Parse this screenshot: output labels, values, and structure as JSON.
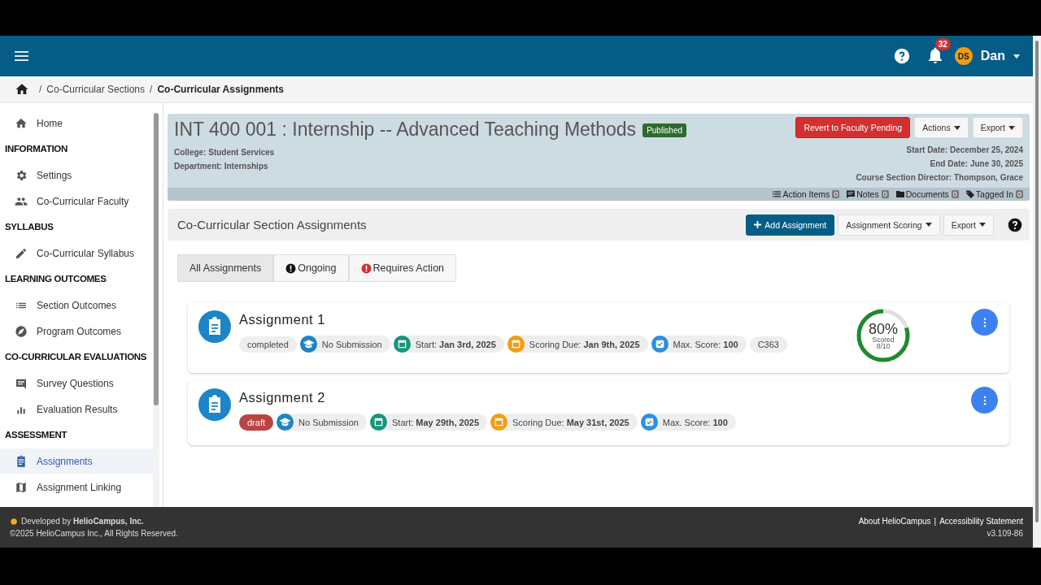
{
  "header": {
    "notification_count": "32",
    "avatar_initials": "DS",
    "user": "Dan"
  },
  "breadcrumb": [
    {
      "separator": "/",
      "label": "Co-Curricular Sections",
      "current": false
    },
    {
      "separator": "/",
      "label": "Co-Curricular Assignments",
      "current": true
    }
  ],
  "sidebar": {
    "items": [
      {
        "kind": "link",
        "label": "Home",
        "selected": false
      },
      {
        "kind": "heading",
        "label": "INFORMATION"
      },
      {
        "kind": "link",
        "label": "Settings",
        "selected": false
      },
      {
        "kind": "link",
        "label": "Co-Curricular Faculty",
        "selected": false
      },
      {
        "kind": "heading",
        "label": "SYLLABUS"
      },
      {
        "kind": "link",
        "label": "Co-Curricular Syllabus",
        "selected": false
      },
      {
        "kind": "heading",
        "label": "LEARNING OUTCOMES"
      },
      {
        "kind": "link",
        "label": "Section Outcomes",
        "selected": false
      },
      {
        "kind": "link",
        "label": "Program Outcomes",
        "selected": false
      },
      {
        "kind": "heading",
        "label": "CO-CURRICULAR EVALUATIONS"
      },
      {
        "kind": "link",
        "label": "Survey Questions",
        "selected": false
      },
      {
        "kind": "link",
        "label": "Evaluation Results",
        "selected": false
      },
      {
        "kind": "heading",
        "label": "ASSESSMENT"
      },
      {
        "kind": "link",
        "label": "Assignments",
        "selected": true
      },
      {
        "kind": "link",
        "label": "Assignment Linking",
        "selected": false
      }
    ]
  },
  "course": {
    "title": "INT 400 001 : Internship -- Advanced Teaching Methods",
    "status": "Published",
    "college": "College: Student Services",
    "department": "Department: Internships",
    "buttons": [
      {
        "label": "Revert to Faculty Pending",
        "kind": "danger"
      },
      {
        "label": "Actions",
        "kind": "dropdown"
      },
      {
        "label": "Export",
        "kind": "dropdown"
      }
    ],
    "details": [
      "Start Date: December 25, 2024",
      "End Date: June 30, 2025",
      "Course Section Director: Thompson, Grace"
    ],
    "counters": [
      {
        "label": "Action Items",
        "count": "0"
      },
      {
        "label": "Notes",
        "count": "0"
      },
      {
        "label": "Documents",
        "count": "0"
      },
      {
        "label": "Tagged In",
        "count": "0"
      }
    ]
  },
  "section": {
    "title": "Co-Curricular Section Assignments",
    "buttons": [
      {
        "label": "Add Assignment",
        "kind": "primary"
      },
      {
        "label": "Assignment Scoring",
        "kind": "dropdown"
      },
      {
        "label": "Export",
        "kind": "dropdown"
      }
    ]
  },
  "filters": [
    {
      "label": "All Assignments",
      "selected": true
    },
    {
      "label": "Ongoing",
      "selected": false
    },
    {
      "label": "Requires Action",
      "selected": false
    }
  ],
  "assignments": [
    {
      "title": "Assignment 1",
      "status": {
        "label": "completed",
        "kind": "completed"
      },
      "submission": "No Submission",
      "start": "Start: **Jan 3rd, 2025**",
      "due": "Scoring Due: **Jan 9th, 2025**",
      "max_score": "Max. Score: **100**",
      "code": "C363",
      "score": {
        "percent": "80%",
        "label": "Scored",
        "fraction": "8/10",
        "level": 0.8
      }
    },
    {
      "title": "Assignment 2",
      "status": {
        "label": "draft",
        "kind": "draft"
      },
      "submission": "No Submission",
      "start": "Start: **May 29th, 2025**",
      "due": "Scoring Due: **May 31st, 2025**",
      "max_score": "Max. Score: **100**"
    }
  ],
  "footer": {
    "developed": "Developed by **HelioCampus, Inc.**",
    "copyright": "©2025 HelioCampus Inc., All Rights Reserved.",
    "links": [
      "About HelioCampus",
      "Accessibility Statement"
    ],
    "separator": "|",
    "version": "v3.109-86"
  }
}
